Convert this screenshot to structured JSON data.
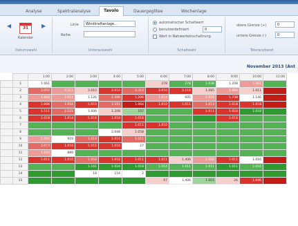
{
  "tabs": [
    {
      "label": "Analyse",
      "active": false
    },
    {
      "label": "Spektralanalyse",
      "active": false
    },
    {
      "label": "Tavolo",
      "active": true
    },
    {
      "label": "Dauergeglitee",
      "active": false
    },
    {
      "label": "Wochenlage",
      "active": false
    }
  ],
  "ribbon": {
    "calendar": {
      "icon_text": "31",
      "label": "Kalender",
      "group_title": "Datumswahl"
    },
    "unterauswahl": {
      "group_title": "Unterauswahl",
      "linie_label": "Linie",
      "linie_value": "Windkraftanlage...",
      "reihe_label": "Reihe"
    },
    "schaltwahl": {
      "group_title": "Schaltwahl",
      "options": [
        {
          "label": "automatischer Schaltwert",
          "type": "radio",
          "checked": true
        },
        {
          "label": "benutzerdefiniert",
          "type": "radio",
          "checked": false,
          "value": "0"
        },
        {
          "label": "Wert in Nahwerteinschaltrung",
          "type": "check",
          "checked": false
        }
      ]
    },
    "toleranzband": {
      "group_title": "Toleranzband",
      "rows": [
        {
          "label": "obere Grenze (+)",
          "value": "0"
        },
        {
          "label": "untere Grenze (-)",
          "value": "0"
        }
      ]
    }
  },
  "table_title": "November 2013 (Ant",
  "grid": {
    "columns": [
      "1:00",
      "2:00",
      "3:00",
      "4:00",
      "5:00",
      "6:00",
      "7:00",
      "8:00",
      "9:00",
      "10:00",
      "11:00"
    ],
    "rows": [
      {
        "label": "1",
        "cells": [
          [
            "w",
            "1.061"
          ],
          [
            "g2",
            ""
          ],
          [
            "g2",
            ""
          ],
          [
            "g2",
            ""
          ],
          [
            "g2",
            ""
          ],
          [
            "p1",
            "278"
          ],
          [
            "g2",
            "278"
          ],
          [
            "g2",
            "1.038"
          ],
          [
            "w",
            "1.208"
          ],
          [
            "p2",
            "1.061"
          ],
          [
            "g2",
            ""
          ]
        ]
      },
      {
        "label": "2",
        "cells": [
          [
            "r1",
            "2.052"
          ],
          [
            "p2",
            "2.311"
          ],
          [
            "p1",
            "2.010"
          ],
          [
            "r2",
            "2.010"
          ],
          [
            "r1",
            "2.310"
          ],
          [
            "r2",
            "2.010"
          ],
          [
            "r2",
            "2.116"
          ],
          [
            "p1",
            "1.085"
          ],
          [
            "p2",
            "1.980"
          ],
          [
            "p1",
            "1.011"
          ],
          [
            "r3",
            ""
          ]
        ]
      },
      {
        "label": "3",
        "cells": [
          [
            "p2",
            "1.004"
          ],
          [
            "p2",
            "1.011"
          ],
          [
            "w",
            "1.126"
          ],
          [
            "r1",
            "1.206"
          ],
          [
            "r2",
            "1.206"
          ],
          [
            "p2",
            "1.014"
          ],
          [
            "w",
            "605"
          ],
          [
            "p2",
            "1.010"
          ],
          [
            "r2",
            "1.738"
          ],
          [
            "w",
            "1.146"
          ],
          [
            "r3",
            ""
          ]
        ]
      },
      {
        "label": "4",
        "cells": [
          [
            "r2",
            "1.006"
          ],
          [
            "r1",
            "1.054"
          ],
          [
            "r2",
            "1.010"
          ],
          [
            "r1",
            "1.151"
          ],
          [
            "r3",
            "1.064"
          ],
          [
            "r2",
            "1.010"
          ],
          [
            "r2",
            "1.011"
          ],
          [
            "r1",
            "1.013"
          ],
          [
            "r2",
            "1.018"
          ],
          [
            "r2",
            "1.018"
          ],
          [
            "r3",
            ""
          ]
        ]
      },
      {
        "label": "5",
        "cells": [
          [
            "r2",
            "1.511"
          ],
          [
            "r1",
            "2.121"
          ],
          [
            "w",
            "1.006"
          ],
          [
            "p1",
            "1.208"
          ],
          [
            "g1",
            "167"
          ],
          [
            "g2",
            ""
          ],
          [
            "g2",
            ""
          ],
          [
            "r2",
            "1.011"
          ],
          [
            "r2",
            "1.024"
          ],
          [
            "g3",
            "1.018"
          ],
          [
            "g3",
            ""
          ]
        ]
      },
      {
        "label": "6",
        "cells": [
          [
            "r2",
            "1.018"
          ],
          [
            "r2",
            "1.014"
          ],
          [
            "r2",
            "1.016"
          ],
          [
            "r2",
            "1.018"
          ],
          [
            "r2",
            "1.016"
          ],
          [
            "g2",
            ""
          ],
          [
            "g2",
            ""
          ],
          [
            "g3",
            ""
          ],
          [
            "r2",
            "1.016"
          ],
          [
            "g2",
            ""
          ],
          [
            "g2",
            ""
          ]
        ]
      },
      {
        "label": "7",
        "cells": [
          [
            "g2",
            ""
          ],
          [
            "g2",
            ""
          ],
          [
            "g2",
            ""
          ],
          [
            "g2",
            ""
          ],
          [
            "r2",
            "1.011"
          ],
          [
            "r2",
            "1.010"
          ],
          [
            "g2",
            ""
          ],
          [
            "g2",
            ""
          ],
          [
            "g2",
            ""
          ],
          [
            "g2",
            ""
          ],
          [
            "g2",
            ""
          ]
        ]
      },
      {
        "label": "8",
        "cells": [
          [
            "g2",
            ""
          ],
          [
            "g2",
            ""
          ],
          [
            "g2",
            ""
          ],
          [
            "w",
            "2.048"
          ],
          [
            "p1",
            "1.058"
          ],
          [
            "g2",
            ""
          ],
          [
            "g2",
            ""
          ],
          [
            "g2",
            ""
          ],
          [
            "g2",
            ""
          ],
          [
            "g2",
            ""
          ],
          [
            "g2",
            ""
          ]
        ]
      },
      {
        "label": "9",
        "cells": [
          [
            "p2",
            "1.064"
          ],
          [
            "w",
            "919"
          ],
          [
            "r1",
            "1.019"
          ],
          [
            "r2",
            "1.016"
          ],
          [
            "r1",
            "1.011"
          ],
          [
            "g2",
            ""
          ],
          [
            "g2",
            ""
          ],
          [
            "g2",
            ""
          ],
          [
            "g2",
            ""
          ],
          [
            "g2",
            ""
          ],
          [
            "g2",
            ""
          ]
        ]
      },
      {
        "label": "10",
        "cells": [
          [
            "r1",
            "2.010"
          ],
          [
            "r2",
            "1.016"
          ],
          [
            "r2",
            "1.015"
          ],
          [
            "r2",
            "1.016"
          ],
          [
            "w",
            "27"
          ],
          [
            "g2",
            ""
          ],
          [
            "g2",
            ""
          ],
          [
            "g2",
            ""
          ],
          [
            "g2",
            ""
          ],
          [
            "g2",
            ""
          ],
          [
            "g2",
            ""
          ]
        ]
      },
      {
        "label": "11",
        "cells": [
          [
            "p2",
            "1.043"
          ],
          [
            "w",
            "889"
          ],
          [
            "g2",
            ""
          ],
          [
            "g2",
            ""
          ],
          [
            "g2",
            ""
          ],
          [
            "g2",
            ""
          ],
          [
            "g2",
            ""
          ],
          [
            "g2",
            ""
          ],
          [
            "g2",
            ""
          ],
          [
            "g2",
            ""
          ],
          [
            "g2",
            ""
          ]
        ]
      },
      {
        "label": "12",
        "cells": [
          [
            "r2",
            "1.011"
          ],
          [
            "r2",
            "1.016"
          ],
          [
            "r1",
            "1.054"
          ],
          [
            "r2",
            "1.016"
          ],
          [
            "r2",
            "1.011"
          ],
          [
            "r2",
            "1.011"
          ],
          [
            "p1",
            "1.406"
          ],
          [
            "p2",
            "1.004"
          ],
          [
            "r2",
            "1.011"
          ],
          [
            "w",
            "1.016"
          ],
          [
            "r3",
            ""
          ]
        ]
      },
      {
        "label": "13",
        "cells": [
          [
            "g2",
            ""
          ],
          [
            "g2",
            ""
          ],
          [
            "g3",
            "1.161"
          ],
          [
            "g3",
            "1.024"
          ],
          [
            "g3",
            "1.018"
          ],
          [
            "g2",
            "1.014"
          ],
          [
            "g2",
            "1.011"
          ],
          [
            "g2",
            "1.011"
          ],
          [
            "g3",
            "1.011"
          ],
          [
            "g2",
            "1.016"
          ],
          [
            "g3",
            ""
          ]
        ]
      },
      {
        "label": "14",
        "cells": [
          [
            "g3",
            ""
          ],
          [
            "g3",
            ""
          ],
          [
            "w",
            "18"
          ],
          [
            "w",
            "154"
          ],
          [
            "w",
            "2"
          ],
          [
            "g3",
            ""
          ],
          [
            "g3",
            ""
          ],
          [
            "g3",
            ""
          ],
          [
            "g3",
            ""
          ],
          [
            "g3",
            ""
          ],
          [
            "g3",
            ""
          ]
        ]
      },
      {
        "label": "15",
        "cells": [
          [
            "g3",
            ""
          ],
          [
            "g3",
            ""
          ],
          [
            "g3",
            ""
          ],
          [
            "g3",
            ""
          ],
          [
            "g3",
            ""
          ],
          [
            "p1",
            "67"
          ],
          [
            "w",
            "1.406"
          ],
          [
            "g1",
            "1.003"
          ],
          [
            "p1",
            "26"
          ],
          [
            "r2",
            "1.046"
          ],
          [
            "r3",
            ""
          ]
        ]
      }
    ]
  }
}
